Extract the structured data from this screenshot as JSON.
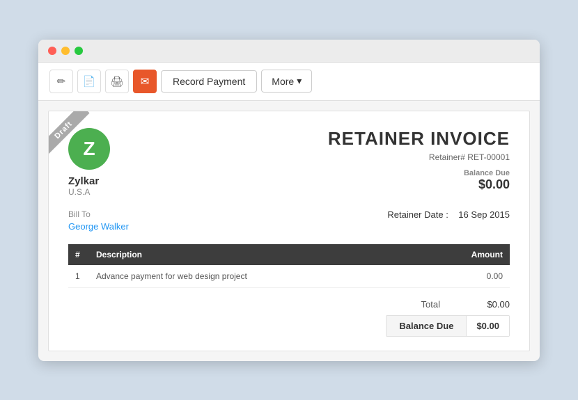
{
  "window": {
    "titlebar": {
      "dots": [
        "red",
        "yellow",
        "green"
      ]
    }
  },
  "toolbar": {
    "icons": [
      "✏",
      "📄",
      "🖨"
    ],
    "email_icon": "✉",
    "record_payment_label": "Record Payment",
    "more_label": "More",
    "more_arrow": "▾"
  },
  "invoice": {
    "draft_label": "Draft",
    "company": {
      "initial": "Z",
      "name": "Zylkar",
      "country": "U.S.A"
    },
    "title": "RETAINER INVOICE",
    "retainer_num_label": "Retainer#",
    "retainer_num": "RET-00001",
    "balance_due_label": "Balance Due",
    "balance_due_amount": "$0.00",
    "bill_to_label": "Bill To",
    "bill_to_name": "George Walker",
    "retainer_date_label": "Retainer Date :",
    "retainer_date": "16 Sep 2015",
    "table": {
      "headers": [
        "#",
        "Description",
        "Amount"
      ],
      "rows": [
        {
          "num": "1",
          "description": "Advance payment for web design project",
          "amount": "0.00"
        }
      ]
    },
    "total_label": "Total",
    "total_value": "$0.00",
    "balance_due_row_label": "Balance Due",
    "balance_due_row_value": "$0.00"
  },
  "colors": {
    "accent_green": "#4caf50",
    "accent_blue": "#2196f3",
    "accent_orange": "#e8572a",
    "table_header_bg": "#3d3d3d"
  }
}
